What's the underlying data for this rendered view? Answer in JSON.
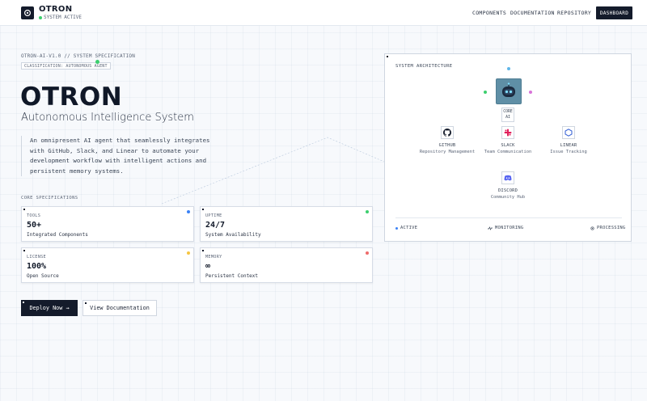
{
  "header": {
    "brand": "OTRON",
    "status": "SYSTEM ACTIVE",
    "nav": [
      "COMPONENTS",
      "DOCUMENTATION",
      "REPOSITORY"
    ],
    "cta": "DASHBOARD"
  },
  "hero": {
    "meta": "OTRON-AI-V1.0 // SYSTEM SPECIFICATION",
    "classification": "CLASSIFICATION: AUTONOMOUS AGENT",
    "title": "OTRON",
    "subtitle": "Autonomous Intelligence System",
    "description": "An omnipresent AI agent that seamlessly integrates with GitHub, Slack, and Linear to automate your development workflow with intelligent actions and persistent memory systems."
  },
  "specs": {
    "section_label": "CORE SPECIFICATIONS",
    "items": [
      {
        "label": "TOOLS",
        "value": "50+",
        "desc": "Integrated Components",
        "color": "#3b82f6"
      },
      {
        "label": "UPTIME",
        "value": "24/7",
        "desc": "System Availability",
        "color": "#3ccf6e"
      },
      {
        "label": "LICENSE",
        "value": "100%",
        "desc": "Open Source",
        "color": "#f5c542"
      },
      {
        "label": "MEMORY",
        "value": "∞",
        "desc": "Persistent Context",
        "color": "#ef6b6b"
      }
    ]
  },
  "actions": {
    "deploy": "Deploy Now →",
    "docs": "View Documentation"
  },
  "architecture": {
    "title": "SYSTEM ARCHITECTURE",
    "core_label": "CORE AI",
    "services": [
      {
        "name": "GITHUB",
        "desc": "Repository Management",
        "icon": "github-icon"
      },
      {
        "name": "SLACK",
        "desc": "Team Communication",
        "icon": "slack-icon"
      },
      {
        "name": "LINEAR",
        "desc": "Issue Tracking",
        "icon": "linear-icon"
      },
      {
        "name": "DISCORD",
        "desc": "Community Hub",
        "icon": "discord-icon"
      }
    ],
    "status": [
      "ACTIVE",
      "MONITORING",
      "PROCESSING"
    ]
  }
}
